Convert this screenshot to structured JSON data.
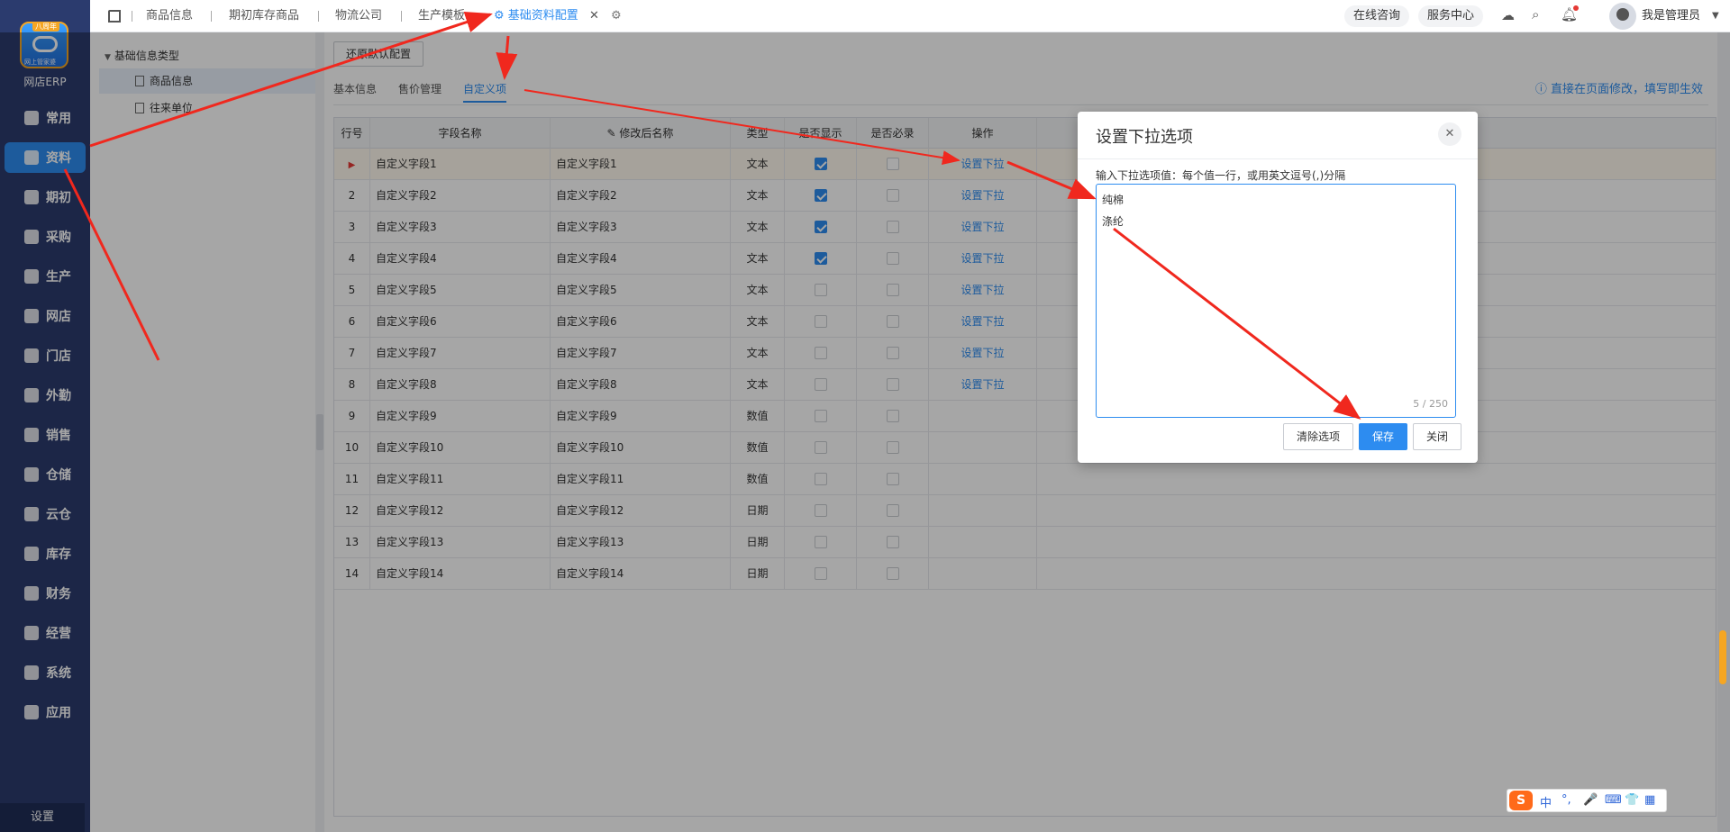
{
  "app": {
    "name": "网店ERP",
    "logo_tag": "八周年",
    "logo_sub": "网上管家婆"
  },
  "nav": {
    "items": [
      {
        "label": "常用",
        "icon": "star-icon"
      },
      {
        "label": "资料",
        "icon": "document-icon",
        "active": true
      },
      {
        "label": "期初",
        "icon": "target-icon"
      },
      {
        "label": "采购",
        "icon": "cart-icon"
      },
      {
        "label": "生产",
        "icon": "factory-icon"
      },
      {
        "label": "网店",
        "icon": "store-icon"
      },
      {
        "label": "门店",
        "icon": "pie-icon"
      },
      {
        "label": "外勤",
        "icon": "compass-icon"
      },
      {
        "label": "销售",
        "icon": "bar-chart-icon"
      },
      {
        "label": "仓储",
        "icon": "warehouse-icon"
      },
      {
        "label": "云仓",
        "icon": "cloud-warehouse-icon"
      },
      {
        "label": "库存",
        "icon": "home-stock-icon"
      },
      {
        "label": "财务",
        "icon": "wallet-icon"
      },
      {
        "label": "经营",
        "icon": "trend-icon"
      },
      {
        "label": "系统",
        "icon": "gear-icon"
      },
      {
        "label": "应用",
        "icon": "plus-square-icon"
      }
    ],
    "bottom": "设置"
  },
  "topbar": {
    "tabs": [
      "商品信息",
      "期初库存商品",
      "物流公司",
      "生产模板",
      "基础资料配置"
    ],
    "active_tab": "基础资料配置",
    "buttons": [
      "在线咨询",
      "服务中心"
    ],
    "user": "我是管理员"
  },
  "tree": {
    "root": "基础信息类型",
    "children": [
      "商品信息",
      "往来单位"
    ],
    "selected": "商品信息"
  },
  "main": {
    "reset_button": "还原默认配置",
    "sub_tabs": [
      "基本信息",
      "售价管理",
      "自定义项"
    ],
    "active_sub_tab": "自定义项",
    "hint": "ⓘ 直接在页面修改，填写即生效",
    "columns": [
      "行号",
      "字段名称",
      "修改后名称",
      "类型",
      "是否显示",
      "是否必录",
      "操作"
    ],
    "rows": [
      {
        "no": "1",
        "name": "自定义字段1",
        "renamed": "自定义字段1",
        "type": "文本",
        "show": true,
        "required": false,
        "action": "设置下拉"
      },
      {
        "no": "2",
        "name": "自定义字段2",
        "renamed": "自定义字段2",
        "type": "文本",
        "show": true,
        "required": false,
        "action": "设置下拉"
      },
      {
        "no": "3",
        "name": "自定义字段3",
        "renamed": "自定义字段3",
        "type": "文本",
        "show": true,
        "required": false,
        "action": "设置下拉"
      },
      {
        "no": "4",
        "name": "自定义字段4",
        "renamed": "自定义字段4",
        "type": "文本",
        "show": true,
        "required": false,
        "action": "设置下拉"
      },
      {
        "no": "5",
        "name": "自定义字段5",
        "renamed": "自定义字段5",
        "type": "文本",
        "show": false,
        "required": false,
        "action": "设置下拉"
      },
      {
        "no": "6",
        "name": "自定义字段6",
        "renamed": "自定义字段6",
        "type": "文本",
        "show": false,
        "required": false,
        "action": "设置下拉"
      },
      {
        "no": "7",
        "name": "自定义字段7",
        "renamed": "自定义字段7",
        "type": "文本",
        "show": false,
        "required": false,
        "action": "设置下拉"
      },
      {
        "no": "8",
        "name": "自定义字段8",
        "renamed": "自定义字段8",
        "type": "文本",
        "show": false,
        "required": false,
        "action": "设置下拉"
      },
      {
        "no": "9",
        "name": "自定义字段9",
        "renamed": "自定义字段9",
        "type": "数值",
        "show": false,
        "required": false,
        "action": ""
      },
      {
        "no": "10",
        "name": "自定义字段10",
        "renamed": "自定义字段10",
        "type": "数值",
        "show": false,
        "required": false,
        "action": ""
      },
      {
        "no": "11",
        "name": "自定义字段11",
        "renamed": "自定义字段11",
        "type": "数值",
        "show": false,
        "required": false,
        "action": ""
      },
      {
        "no": "12",
        "name": "自定义字段12",
        "renamed": "自定义字段12",
        "type": "日期",
        "show": false,
        "required": false,
        "action": ""
      },
      {
        "no": "13",
        "name": "自定义字段13",
        "renamed": "自定义字段13",
        "type": "日期",
        "show": false,
        "required": false,
        "action": ""
      },
      {
        "no": "14",
        "name": "自定义字段14",
        "renamed": "自定义字段14",
        "type": "日期",
        "show": false,
        "required": false,
        "action": ""
      }
    ]
  },
  "modal": {
    "title": "设置下拉选项",
    "label": "输入下拉选项值：每个值一行，或用英文逗号(,)分隔",
    "options": [
      "纯棉",
      "涤纶"
    ],
    "counter": "5 / 250",
    "buttons": {
      "clear": "清除选项",
      "save": "保存",
      "close": "关闭"
    }
  },
  "ime": {
    "chars": [
      "中",
      "°,",
      "🎤",
      "⌨",
      "👕",
      "▦"
    ]
  },
  "colors": {
    "accent": "#2d8cf0",
    "nav_bg": "#2b3b6e",
    "arrow": "#f0281e"
  }
}
